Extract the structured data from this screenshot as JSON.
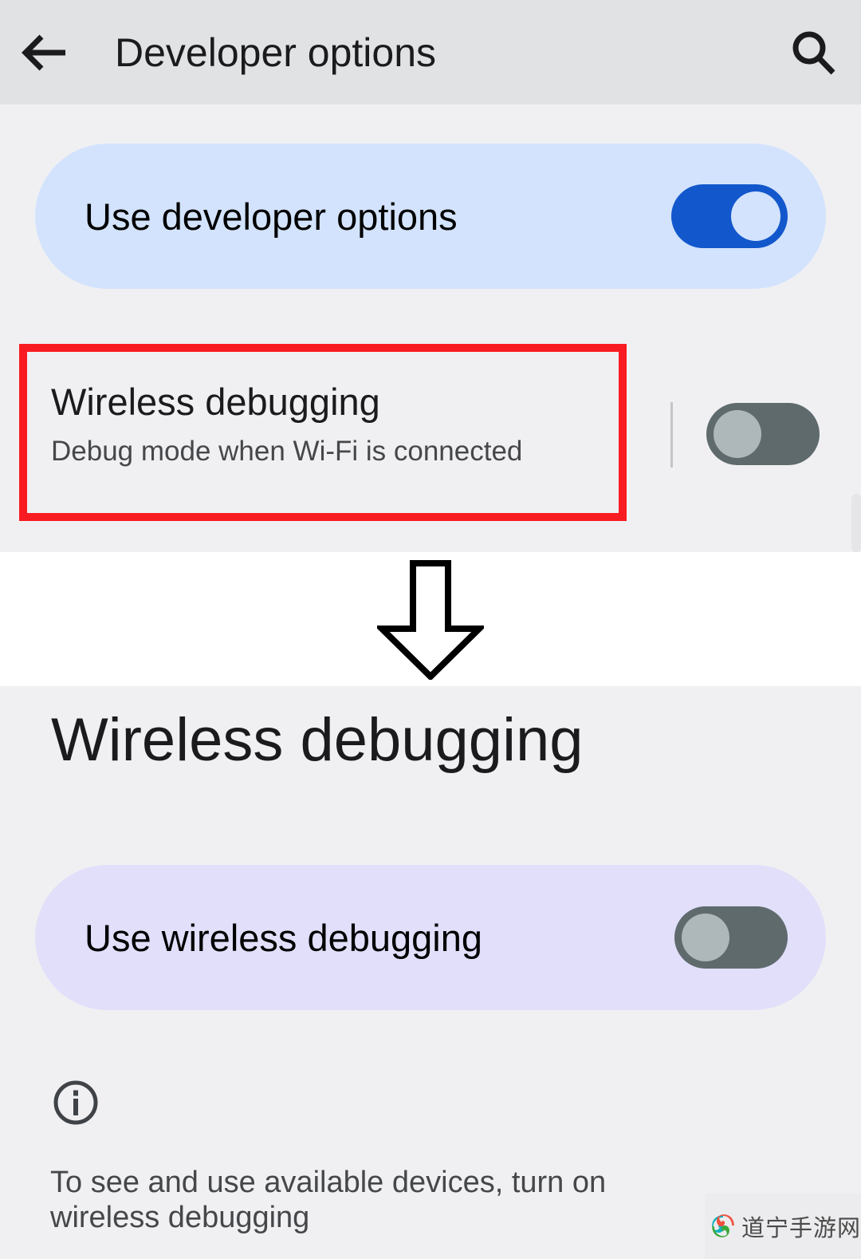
{
  "screen_one": {
    "appbar": {
      "back_icon": "back-arrow-icon",
      "title": "Developer options",
      "search_icon": "search-icon"
    },
    "use_developer_options": {
      "label": "Use developer options",
      "toggle_state": "on",
      "toggle_on_color": "#1258cc",
      "card_color": "#d3e3fd"
    },
    "wireless_debugging_row": {
      "title": "Wireless debugging",
      "subtitle": "Debug mode when Wi-Fi is connected",
      "toggle_state": "off",
      "toggle_off_color": "#5f6a6d",
      "highlight_color": "#f81c22"
    }
  },
  "transition": {
    "arrow_icon": "arrow-down-outline-icon"
  },
  "screen_two": {
    "page_title": "Wireless debugging",
    "use_wireless_debugging": {
      "label": "Use wireless debugging",
      "toggle_state": "off",
      "card_color": "#e1dffa"
    },
    "info": {
      "icon": "info-circle-icon",
      "text": "To see and use available devices, turn on wireless debugging"
    }
  },
  "watermark": {
    "text": "道宁手游网",
    "colors": {
      "teal": "#13b0bd",
      "green": "#3aa93a",
      "red": "#f0503c"
    }
  }
}
